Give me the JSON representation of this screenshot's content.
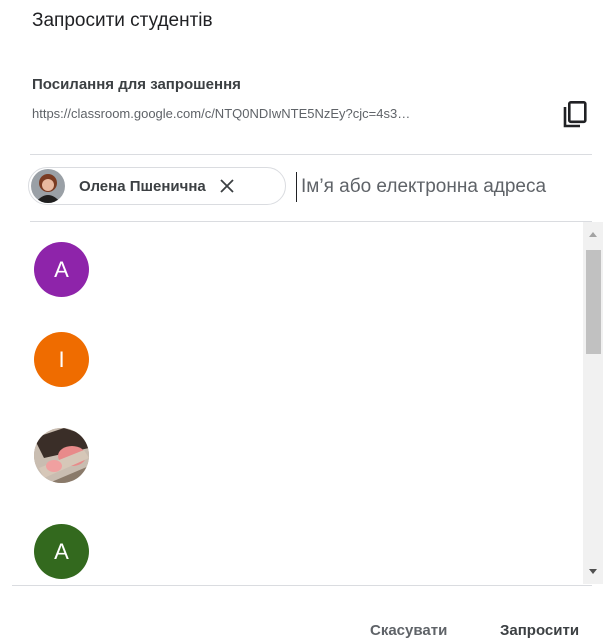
{
  "dialog": {
    "title": "Запросити студентів"
  },
  "invite_link": {
    "label": "Посилання для запрошення",
    "url": "https://classroom.google.com/c/NTQ0NDIwNTE5NzEy?cjc=4s3…",
    "copy_icon": "copy-icon"
  },
  "recipients": {
    "chips": [
      {
        "name": "Олена Пшенична",
        "remove_icon": "close-icon"
      }
    ],
    "input": {
      "value": "",
      "placeholder": "Ім’я або електронна адреса"
    }
  },
  "suggestions": [
    {
      "initial": "A",
      "color": "#8e24aa"
    },
    {
      "initial": "I",
      "color": "#ef6c00"
    },
    {
      "initial": "",
      "color": "#b0a49a",
      "photo": true
    },
    {
      "initial": "A",
      "color": "#33691e"
    }
  ],
  "actions": {
    "cancel_label": "Скасувати",
    "invite_label": "Запросити"
  }
}
